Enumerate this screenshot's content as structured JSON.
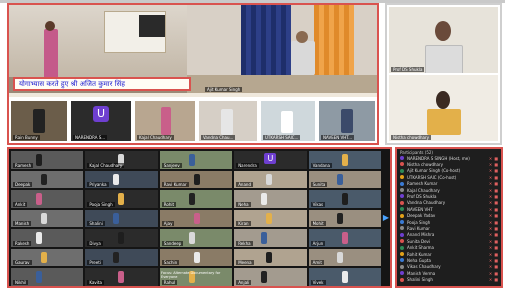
{
  "banner": {
    "text": "योगाभ्यास करते हुए श्री अजित कुमार सिंह",
    "text_color": "#1a1ad0"
  },
  "top_main": {
    "speaker_label": "Ajit Kumar Singh"
  },
  "top_strip": [
    {
      "label": "Rain Bunny"
    },
    {
      "label": "NARENDRA S...",
      "avatar": "U"
    },
    {
      "label": "Kajal Chaudhary"
    },
    {
      "label": "Vandna Chau..."
    },
    {
      "label": "UTKARSH SAIC..."
    },
    {
      "label": "NAVEEN VHT..."
    }
  ],
  "right_tiles": [
    {
      "label": "Prof DS Shukla"
    },
    {
      "label": "Nistha chowdhary"
    }
  ],
  "gallery": {
    "cells": [
      {
        "label": "Ramesh"
      },
      {
        "label": "Kajal Chaudhary"
      },
      {
        "label": "Sanjeev"
      },
      {
        "label": "Narendra",
        "avatar": "U"
      },
      {
        "label": "Vandana"
      },
      {
        "label": "Deepak"
      },
      {
        "label": "Priyanka"
      },
      {
        "label": "Ravi Kumar"
      },
      {
        "label": "Anand"
      },
      {
        "label": "Sunita"
      },
      {
        "label": "Ankit"
      },
      {
        "label": "Pooja Singh"
      },
      {
        "label": "Rohit"
      },
      {
        "label": "Neha"
      },
      {
        "label": "Vikas"
      },
      {
        "label": "Manish"
      },
      {
        "label": "Shalini"
      },
      {
        "label": "Ajay"
      },
      {
        "label": "Kiran"
      },
      {
        "label": "Mohit"
      },
      {
        "label": "Rakesh"
      },
      {
        "label": "Divya"
      },
      {
        "label": "Sandeep"
      },
      {
        "label": "Rekha"
      },
      {
        "label": "Arjun"
      },
      {
        "label": "Gaurav"
      },
      {
        "label": "Preeti"
      },
      {
        "label": "Sachin"
      },
      {
        "label": "Meena"
      },
      {
        "label": "Amit"
      },
      {
        "label": "Nikhil"
      },
      {
        "label": "Kavita"
      },
      {
        "label": "Rahul"
      },
      {
        "label": "Anjali"
      },
      {
        "label": "Vivek"
      }
    ],
    "promo_text": "Focus: Alternate Documentary for Everyone",
    "next_arrow": "▶"
  },
  "participants": {
    "title": "Participants (52)",
    "rows": [
      {
        "name": "NARENDRA S SINGH (Host, me)"
      },
      {
        "name": "Nistha chowdhary"
      },
      {
        "name": "Ajit Kumar Singh (Co-host)"
      },
      {
        "name": "UTKARSH SAIC (Co-host)"
      },
      {
        "name": "Ramesh Kumar"
      },
      {
        "name": "Kajal Chaudhary"
      },
      {
        "name": "Prof DS Shukla"
      },
      {
        "name": "Vandna Chaudhary"
      },
      {
        "name": "NAVEEN VHT"
      },
      {
        "name": "Deepak Yadav"
      },
      {
        "name": "Pooja Singh"
      },
      {
        "name": "Ravi Kumar"
      },
      {
        "name": "Anand Mishra"
      },
      {
        "name": "Sunita Devi"
      },
      {
        "name": "Ankit Sharma"
      },
      {
        "name": "Rohit Kumar"
      },
      {
        "name": "Neha Gupta"
      },
      {
        "name": "Vikas Chaudhary"
      },
      {
        "name": "Manish Verma"
      },
      {
        "name": "Shalini Singh"
      }
    ]
  },
  "colors": {
    "frame": "#d9534f",
    "tile_bg": "#3a3a3a",
    "sidebar_bg": "#1e1e1e",
    "avatar_purple": "#6e3fd0"
  }
}
